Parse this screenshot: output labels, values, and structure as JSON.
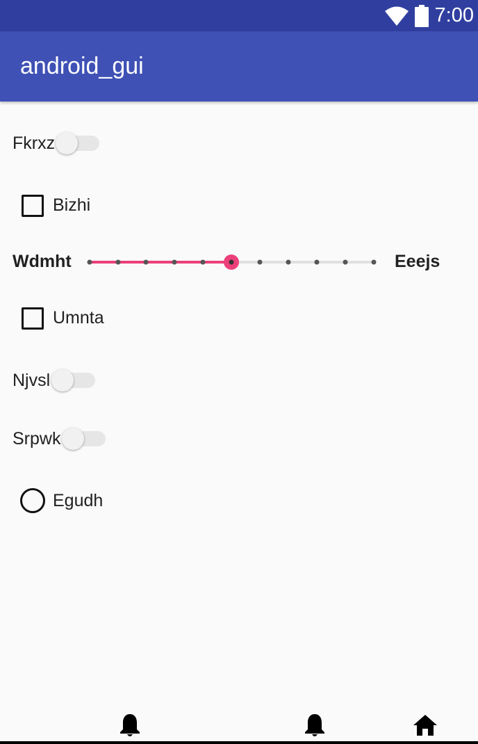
{
  "status_bar": {
    "time": "7:00",
    "icons": [
      "wifi-icon",
      "battery-icon"
    ],
    "color": "#303f9f"
  },
  "app_bar": {
    "title": "android_gui",
    "color": "#3f51b5"
  },
  "controls": {
    "switch_fkrxz": {
      "label": "Fkrxz",
      "checked": false
    },
    "checkbox_bizhi": {
      "label": "Bizhi",
      "checked": false
    },
    "seekbar": {
      "start_label": "Wdmht",
      "end_label": "Eeejs",
      "min": 0,
      "max": 10,
      "value": 5,
      "accent_color": "#ec407a"
    },
    "checkbox_umnta": {
      "label": "Umnta",
      "checked": false
    },
    "switch_njvsl": {
      "label": "Njvsl",
      "checked": false
    },
    "switch_srpwk": {
      "label": "Srpwk",
      "checked": false
    },
    "radio_egudh": {
      "label": "Egudh",
      "checked": false
    }
  },
  "bottom_nav": {
    "icons": [
      "bell-icon",
      "bell-icon",
      "home-icon"
    ]
  }
}
